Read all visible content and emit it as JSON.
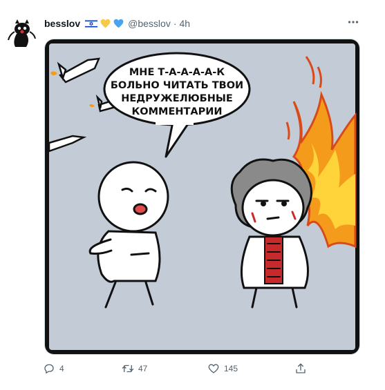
{
  "tweet": {
    "display_name": "besslov",
    "badges": [
      "flag-israel-icon",
      "yellow-heart-icon",
      "blue-heart-icon"
    ],
    "handle": "@besslov",
    "separator": "·",
    "time": "4h",
    "more_icon": "more-horizontal-icon"
  },
  "comic": {
    "speech_lines": [
      "МНЕ Т-А-А-А-А-К",
      "БОЛЬНО ЧИТАТЬ ТВОИ",
      "НЕДРУЖЕЛЮБНЫЕ",
      "КОММЕНТАРИИ"
    ]
  },
  "actions": {
    "reply": {
      "icon": "reply-icon",
      "count": "4"
    },
    "retweet": {
      "icon": "retweet-icon",
      "count": "47"
    },
    "like": {
      "icon": "like-icon",
      "count": "145"
    },
    "share": {
      "icon": "share-icon"
    }
  },
  "colors": {
    "accent_blue": "#1d9bf0",
    "panel_bg": "#c3ccd6",
    "muted_text": "#536471",
    "flag_blue": "#0038b8",
    "heart_yellow": "#f7c948",
    "heart_blue": "#4aa3ef"
  }
}
